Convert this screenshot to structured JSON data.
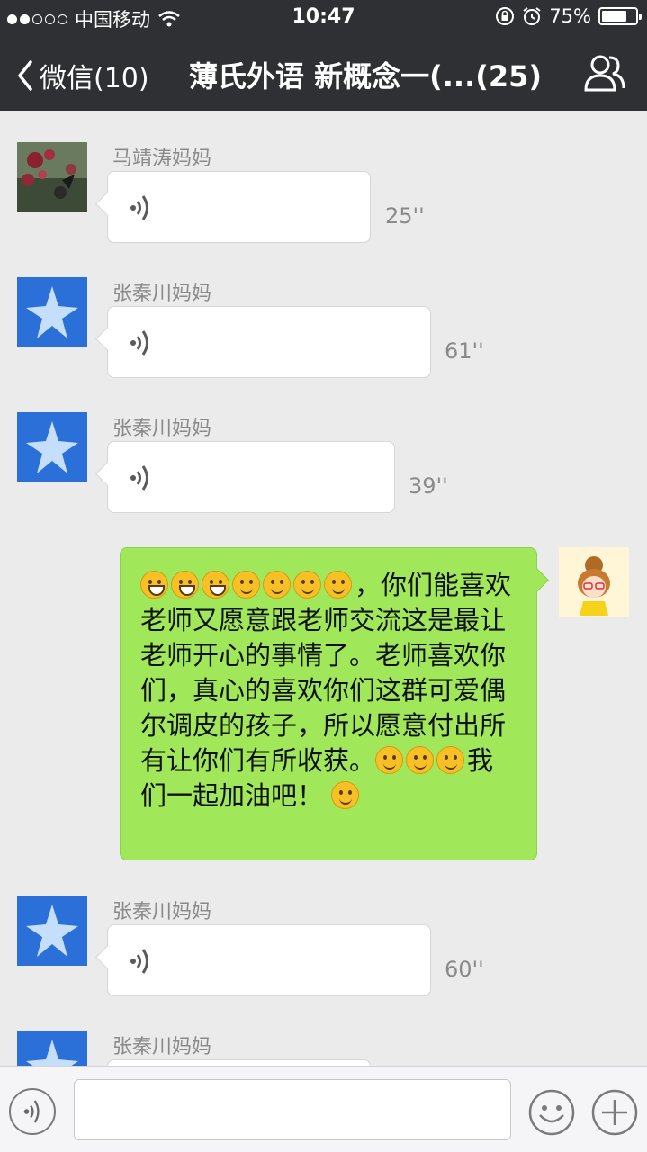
{
  "status_bar": {
    "carrier": "中国移动",
    "time": "10:47",
    "battery": "75%",
    "battery_level": 0.75
  },
  "nav": {
    "back_label": "微信(10)",
    "title": "薄氏外语 新概念一(...(25)"
  },
  "messages": [
    {
      "sender": "马靖涛妈妈",
      "duration": "25''"
    },
    {
      "sender": "张秦川妈妈",
      "duration": "61''"
    },
    {
      "sender": "张秦川妈妈",
      "duration": "39''"
    },
    {
      "text_line1": "，你们能",
      "text_body": "喜欢老师又愿意跟老师交流这是最让老师开心的事情了。老师喜欢你们，真心的喜欢你们这群可爱偶尔调皮的孩子，所以愿意付出所有让你们有所收获。",
      "text_tail": "我们一起加油吧！"
    },
    {
      "sender": "张秦川妈妈",
      "duration": "60''"
    },
    {
      "sender": "张秦川妈妈"
    }
  ],
  "icons": [
    "back-chevron-icon",
    "group-members-icon",
    "voice-wave-icon",
    "voice-input-icon",
    "emoji-icon",
    "plus-icon",
    "smile-emoji-icon",
    "grin-emoji-icon",
    "thinking-emoji-icon"
  ],
  "colors": {
    "header": "#2e3034",
    "chat_bg": "#ebebeb",
    "sent_bubble": "#a0e75a"
  }
}
